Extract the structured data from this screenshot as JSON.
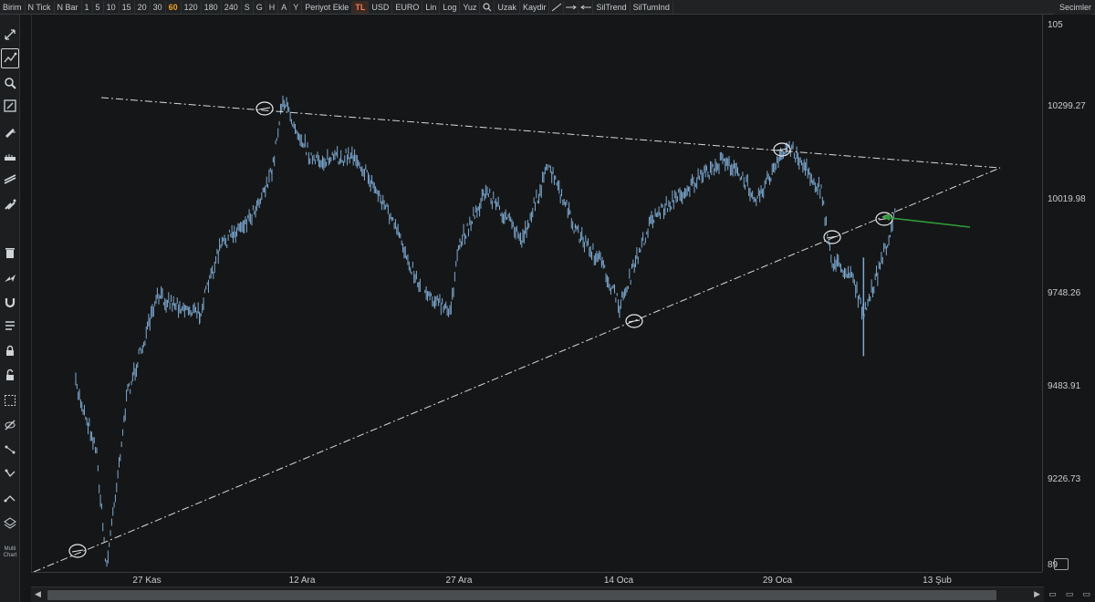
{
  "toolbar": {
    "buttons": [
      {
        "label": "Birim"
      },
      {
        "label": "N Tick"
      },
      {
        "label": "N Bar"
      },
      {
        "label": "1"
      },
      {
        "label": "5"
      },
      {
        "label": "10"
      },
      {
        "label": "15"
      },
      {
        "label": "20"
      },
      {
        "label": "30"
      },
      {
        "label": "60",
        "active": true
      },
      {
        "label": "120"
      },
      {
        "label": "180"
      },
      {
        "label": "240"
      },
      {
        "label": "S"
      },
      {
        "label": "G"
      },
      {
        "label": "H"
      },
      {
        "label": "A"
      },
      {
        "label": "Y"
      },
      {
        "label": "Periyot Ekle"
      },
      {
        "label": "TL",
        "highlight": true
      },
      {
        "label": "USD"
      },
      {
        "label": "EURO"
      },
      {
        "label": "Lin"
      },
      {
        "label": "Log"
      },
      {
        "label": "Yuz"
      },
      {
        "label": "Uzak"
      },
      {
        "label": "Kaydir"
      },
      {
        "label": "SilTrend"
      },
      {
        "label": "SilTumInd"
      }
    ],
    "selections_label": "Secimler"
  },
  "sidebar": {
    "items": [
      {
        "icon": "expand-arrows-icon"
      },
      {
        "icon": "trend-line-tool-icon",
        "active": true
      },
      {
        "icon": "magnifier-icon"
      },
      {
        "icon": "zoom-box-icon"
      },
      {
        "icon": "pencil-icon"
      },
      {
        "icon": "ruler-icon"
      },
      {
        "icon": "channel-tool-icon"
      },
      {
        "icon": "brush-icon"
      },
      {
        "icon": "trash-icon"
      },
      {
        "icon": "arrow-tool-icon"
      },
      {
        "icon": "magnet-icon"
      },
      {
        "icon": "lines-tool-icon"
      },
      {
        "icon": "lock-icon"
      },
      {
        "icon": "unlock-icon"
      },
      {
        "icon": "select-area-icon"
      },
      {
        "icon": "hide-icon"
      },
      {
        "icon": "node-tool-icon"
      },
      {
        "icon": "pattern-tool-icon"
      },
      {
        "icon": "path-tool-icon"
      },
      {
        "icon": "layers-icon"
      }
    ],
    "multi_chart_label": "Multi Chart"
  },
  "price_scale": {
    "labels": [
      "105",
      "10299.27",
      "10019.98",
      "9748.26",
      "9483.91",
      "9226.73",
      "89"
    ]
  },
  "date_axis": {
    "labels": [
      "27 Kas",
      "12 Ara",
      "27 Ara",
      "14 Oca",
      "29 Oca",
      "13 Şub"
    ]
  },
  "colors": {
    "background": "#151617",
    "bars": "#7eaad3",
    "trend_lines": "#d8dadc",
    "annotation_arrow": "#2f9d3a",
    "marker_circles": "#e8eaec"
  },
  "chart_data": {
    "type": "bar",
    "subtype": "ohlc-hourly-price",
    "currency": "TL",
    "interval": "60",
    "y_axis_labels": [
      10299.27,
      10019.98,
      9748.26,
      9483.91,
      9226.73
    ],
    "x_axis_labels": [
      "27 Kas",
      "12 Ara",
      "27 Ara",
      "14 Oca",
      "29 Oca",
      "13 Şub"
    ],
    "approx_close_path": [
      {
        "date": "20 Kas",
        "close": 9480
      },
      {
        "date": "22 Kas",
        "close": 9300
      },
      {
        "date": "23 Kas",
        "close": 8960
      },
      {
        "date": "25 Kas",
        "close": 9450
      },
      {
        "date": "28 Kas",
        "close": 9730
      },
      {
        "date": "2 Ara",
        "close": 9680
      },
      {
        "date": "4 Ara",
        "close": 9870
      },
      {
        "date": "7 Ara",
        "close": 9960
      },
      {
        "date": "9 Ara",
        "close": 10080
      },
      {
        "date": "10 Ara",
        "close": 10290
      },
      {
        "date": "13 Ara",
        "close": 10110
      },
      {
        "date": "17 Ara",
        "close": 10130
      },
      {
        "date": "20 Ara",
        "close": 9980
      },
      {
        "date": "23 Ara",
        "close": 9770
      },
      {
        "date": "26 Ara",
        "close": 9680
      },
      {
        "date": "27 Ara",
        "close": 9880
      },
      {
        "date": "30 Ara",
        "close": 10030
      },
      {
        "date": "3 Oca",
        "close": 9890
      },
      {
        "date": "6 Oca",
        "close": 10100
      },
      {
        "date": "9 Oca",
        "close": 9920
      },
      {
        "date": "12 Oca",
        "close": 9820
      },
      {
        "date": "14 Oca",
        "close": 9700
      },
      {
        "date": "17 Oca",
        "close": 9950
      },
      {
        "date": "21 Oca",
        "close": 10050
      },
      {
        "date": "24 Oca",
        "close": 10120
      },
      {
        "date": "27 Oca",
        "close": 10010
      },
      {
        "date": "30 Oca",
        "close": 10160
      },
      {
        "date": "2 Şub",
        "close": 10030
      },
      {
        "date": "3 Şub",
        "close": 9830
      },
      {
        "date": "5 Şub",
        "close": 9790
      },
      {
        "date": "6 Şub",
        "close": 9670
      },
      {
        "date": "8 Şub",
        "close": 9860
      },
      {
        "date": "9 Şub",
        "close": 9960
      }
    ],
    "trend_lines": [
      {
        "name": "upper-resistance",
        "style": "dash-dot"
      },
      {
        "name": "lower-support",
        "style": "dash-dot"
      }
    ],
    "marked_points": 6,
    "annotation": "green arrow pointing at the latest bar near support line"
  }
}
